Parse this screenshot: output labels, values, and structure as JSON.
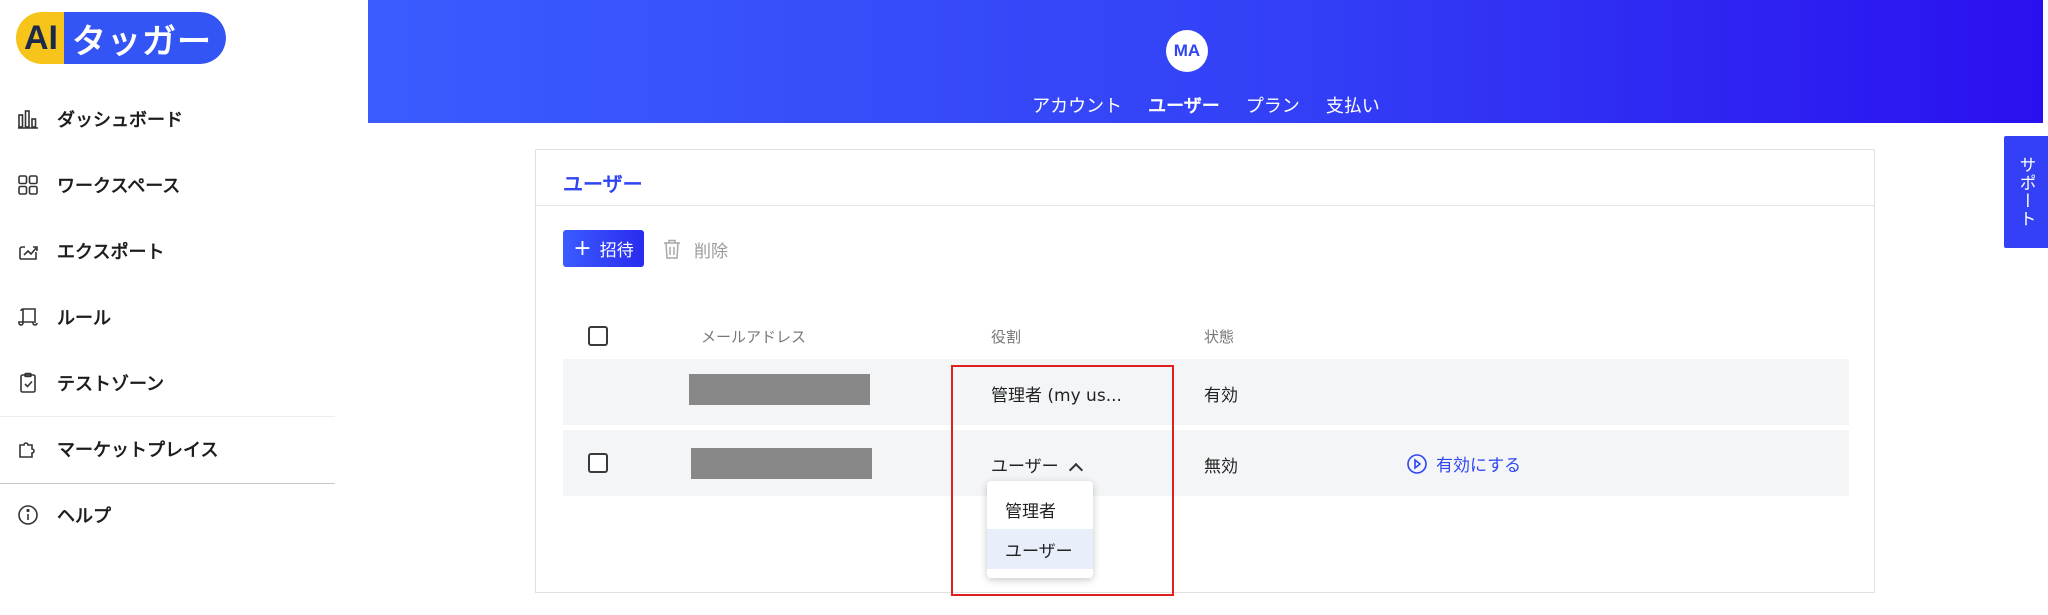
{
  "logo": {
    "ai": "AI",
    "word": "タッガー"
  },
  "sidebar": {
    "items": [
      {
        "label": "ダッシュボード",
        "icon": "bar-chart-icon"
      },
      {
        "label": "ワークスペース",
        "icon": "grid-icon"
      },
      {
        "label": "エクスポート",
        "icon": "export-icon"
      },
      {
        "label": "ルール",
        "icon": "scroll-icon"
      },
      {
        "label": "テストゾーン",
        "icon": "clipboard-check-icon"
      },
      {
        "label": "マーケットプレイス",
        "icon": "puzzle-icon"
      },
      {
        "label": "ヘルプ",
        "icon": "info-icon"
      }
    ]
  },
  "header": {
    "avatar": "MA",
    "tabs": [
      {
        "label": "アカウント",
        "active": false
      },
      {
        "label": "ユーザー",
        "active": true
      },
      {
        "label": "プラン",
        "active": false
      },
      {
        "label": "支払い",
        "active": false
      }
    ]
  },
  "support": {
    "label": "サポート"
  },
  "card": {
    "title": "ユーザー",
    "invite_label": "招待",
    "delete_label": "削除",
    "columns": {
      "email": "メールアドレス",
      "role": "役割",
      "status": "状態"
    },
    "rows": [
      {
        "role": "管理者 (my us...",
        "status": "有効",
        "action": ""
      },
      {
        "role": "ユーザー",
        "status": "無効",
        "action": "有効にする"
      }
    ]
  },
  "role_dropdown": {
    "options": [
      "管理者",
      "ユーザー"
    ],
    "selected": "ユーザー"
  },
  "colors": {
    "accent": "#2f45f3",
    "logo_yellow": "#f6c41a",
    "highlight": "#e02020"
  }
}
